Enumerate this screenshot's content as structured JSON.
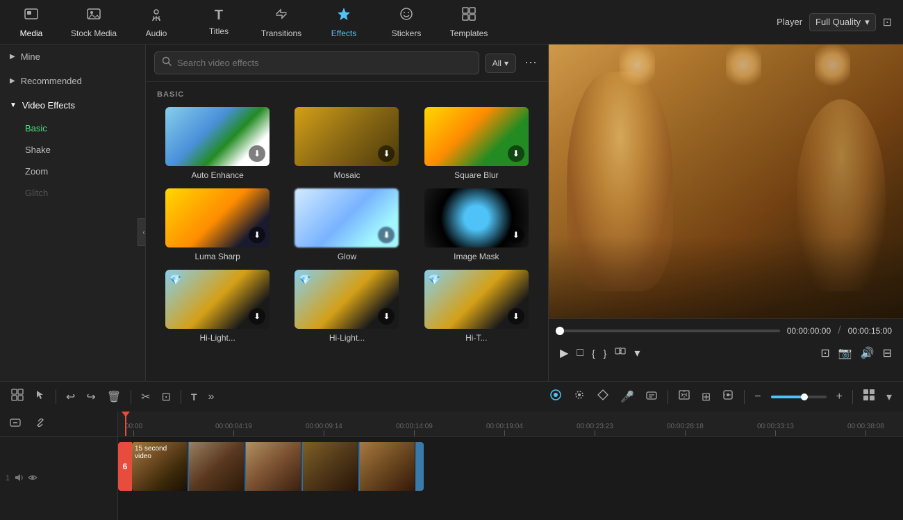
{
  "nav": {
    "items": [
      {
        "id": "media",
        "label": "Media",
        "icon": "🖼",
        "active": false
      },
      {
        "id": "stock-media",
        "label": "Stock Media",
        "icon": "📷",
        "active": false
      },
      {
        "id": "audio",
        "label": "Audio",
        "icon": "🎵",
        "active": false
      },
      {
        "id": "titles",
        "label": "Titles",
        "icon": "T",
        "active": false
      },
      {
        "id": "transitions",
        "label": "Transitions",
        "icon": "↔",
        "active": false
      },
      {
        "id": "effects",
        "label": "Effects",
        "icon": "✦",
        "active": true
      },
      {
        "id": "stickers",
        "label": "Stickers",
        "icon": "🏷",
        "active": false
      },
      {
        "id": "templates",
        "label": "Templates",
        "icon": "⊞",
        "active": false
      }
    ],
    "player_label": "Player",
    "quality_label": "Full Quality"
  },
  "sidebar": {
    "items": [
      {
        "id": "mine",
        "label": "Mine",
        "type": "parent",
        "expanded": false
      },
      {
        "id": "recommended",
        "label": "Recommended",
        "type": "parent",
        "expanded": false
      },
      {
        "id": "video-effects",
        "label": "Video Effects",
        "type": "parent",
        "expanded": true
      }
    ],
    "sub_items": [
      {
        "id": "basic",
        "label": "Basic",
        "active": true
      },
      {
        "id": "shake",
        "label": "Shake",
        "active": false
      },
      {
        "id": "zoom",
        "label": "Zoom",
        "active": false
      },
      {
        "id": "glitch",
        "label": "Glitch",
        "active": false,
        "disabled": true
      }
    ]
  },
  "effects": {
    "search_placeholder": "Search video effects",
    "filter_label": "All",
    "section_label": "BASIC",
    "items": [
      {
        "id": "auto-enhance",
        "name": "Auto Enhance",
        "thumb_class": "thumb-auto"
      },
      {
        "id": "mosaic",
        "name": "Mosaic",
        "thumb_class": "thumb-mosaic"
      },
      {
        "id": "square-blur",
        "name": "Square Blur",
        "thumb_class": "thumb-squarblur"
      },
      {
        "id": "luma-sharp",
        "name": "Luma Sharp",
        "thumb_class": "thumb-luma"
      },
      {
        "id": "glow",
        "name": "Glow",
        "thumb_class": "thumb-glow"
      },
      {
        "id": "image-mask",
        "name": "Image Mask",
        "thumb_class": "thumb-mask"
      },
      {
        "id": "highlight1",
        "name": "Hi-Light...",
        "thumb_class": "thumb-highlight1",
        "badge": "💎"
      },
      {
        "id": "highlight2",
        "name": "Hi-Light...",
        "thumb_class": "thumb-highlight2",
        "badge": "💎"
      },
      {
        "id": "highlight3",
        "name": "Hi-T...",
        "thumb_class": "thumb-highlight3",
        "badge": "💎"
      }
    ]
  },
  "player": {
    "current_time": "00:00:00:00",
    "total_time": "00:00:15:00",
    "progress_percent": 0
  },
  "timeline": {
    "ruler_marks": [
      "00:00",
      "00:00:04:19",
      "00:00:09:14",
      "00:00:14:09",
      "00:00:19:04",
      "00:00:23:23",
      "00:00:28:18",
      "00:00:33:13",
      "00:00:38:08"
    ],
    "clip_label": "15 second video",
    "red_marker": "6"
  },
  "toolbar": {
    "tools": [
      "⊞",
      "↖",
      "↩",
      "↪",
      "🗑",
      "✂",
      "⊡",
      "T",
      "»"
    ],
    "right_tools": [
      "⚙",
      "🎭",
      "🔷",
      "🎤",
      "📋",
      "🎬",
      "👁",
      "⊞",
      "🔊",
      "⊟"
    ]
  }
}
